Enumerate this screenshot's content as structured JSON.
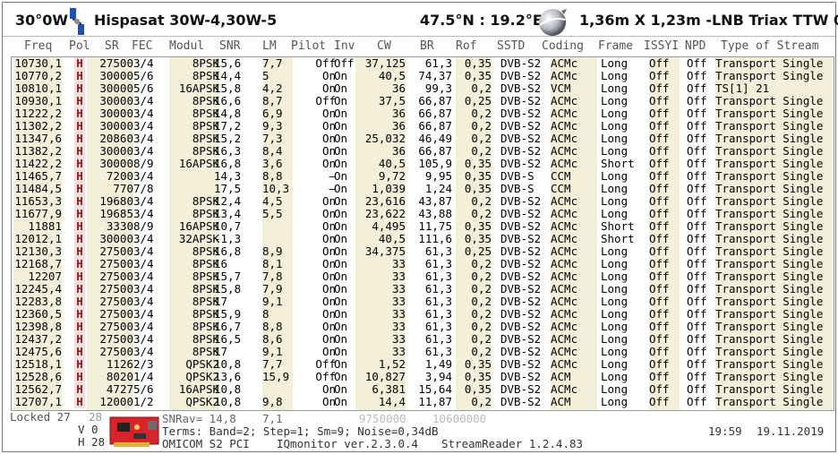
{
  "header": {
    "orbit": "30°0W",
    "satellite": "Hispasat 30W-4,30W-5",
    "coords": "47.5°N : 19.2°E",
    "dish": "1,36m X 1,23m -LNB Triax TTW 006"
  },
  "columns": [
    "Freq",
    "Pol",
    "SR",
    "FEC",
    "Modul",
    "SNR",
    "LM",
    "Pilot",
    "Inv",
    "CW",
    "BR",
    "Rof",
    "SSTD",
    "Coding",
    "Frame",
    "ISSYI",
    "NPD",
    "Type of Stream"
  ],
  "rows": [
    [
      "10730,1",
      "H",
      "27500",
      "3/4",
      "8PSK",
      "15,6",
      "7,7",
      "Off",
      "Off",
      "37,125",
      "61,3",
      "0,35",
      "DVB-S2",
      "ACMc",
      "Long",
      "Off",
      "Off",
      "Transport Single"
    ],
    [
      "10770,2",
      "H",
      "30000",
      "5/6",
      "8PSK",
      "14,4",
      "5",
      "On",
      "On",
      "40,5",
      "74,37",
      "0,35",
      "DVB-S2",
      "ACMc",
      "Long",
      "Off",
      "Off",
      "Transport Single"
    ],
    [
      "10810,1",
      "H",
      "30000",
      "5/6",
      "16APSK",
      "15,8",
      "4,2",
      "On",
      "On",
      "36",
      "99,3",
      "0,2",
      "DVB-S2",
      "VCM",
      "Long",
      "Off",
      "Off",
      "TS[1] 21"
    ],
    [
      "10930,1",
      "H",
      "30000",
      "3/4",
      "8PSK",
      "16,6",
      "8,7",
      "Off",
      "On",
      "37,5",
      "66,87",
      "0,25",
      "DVB-S2",
      "ACMc",
      "Long",
      "Off",
      "Off",
      "Transport Single"
    ],
    [
      "11222,2",
      "H",
      "30000",
      "3/4",
      "8PSK",
      "14,8",
      "6,9",
      "On",
      "On",
      "36",
      "66,87",
      "0,2",
      "DVB-S2",
      "ACMc",
      "Long",
      "Off",
      "Off",
      "Transport Single"
    ],
    [
      "11302,2",
      "H",
      "30000",
      "3/4",
      "8PSK",
      "17,2",
      "9,3",
      "On",
      "On",
      "36",
      "66,87",
      "0,2",
      "DVB-S2",
      "ACMc",
      "Long",
      "Off",
      "Off",
      "Transport Single"
    ],
    [
      "11347,6",
      "H",
      "20860",
      "3/4",
      "8PSK",
      "15,2",
      "7,3",
      "On",
      "On",
      "25,032",
      "46,49",
      "0,2",
      "DVB-S2",
      "ACMc",
      "Long",
      "Off",
      "Off",
      "Transport Single"
    ],
    [
      "11382,2",
      "H",
      "30000",
      "3/4",
      "8PSK",
      "16,3",
      "8,4",
      "On",
      "On",
      "36",
      "66,87",
      "0,2",
      "DVB-S2",
      "ACMc",
      "Long",
      "Off",
      "Off",
      "Transport Single"
    ],
    [
      "11422,2",
      "H",
      "30000",
      "8/9",
      "16APSK",
      "16,8",
      "3,6",
      "On",
      "On",
      "40,5",
      "105,9",
      "0,35",
      "DVB-S2",
      "ACMc",
      "Short",
      "Off",
      "Off",
      "Transport Single"
    ],
    [
      "11465,7",
      "H",
      "7200",
      "3/4",
      "",
      "14,3",
      "8,8",
      "–",
      "On",
      "9,72",
      "9,95",
      "0,35",
      "DVB-S",
      "CCM",
      "Long",
      "Off",
      "Off",
      "Transport Single"
    ],
    [
      "11484,5",
      "H",
      "770",
      "7/8",
      "",
      "17,5",
      "10,3",
      "–",
      "On",
      "1,039",
      "1,24",
      "0,35",
      "DVB-S",
      "CCM",
      "Long",
      "Off",
      "Off",
      "Transport Single"
    ],
    [
      "11653,3",
      "H",
      "19680",
      "3/4",
      "8PSK",
      "12,4",
      "4,5",
      "On",
      "On",
      "23,616",
      "43,87",
      "0,2",
      "DVB-S2",
      "ACMc",
      "Long",
      "Off",
      "Off",
      "Transport Single"
    ],
    [
      "11677,9",
      "H",
      "19685",
      "3/4",
      "8PSK",
      "13,4",
      "5,5",
      "On",
      "On",
      "23,622",
      "43,88",
      "0,2",
      "DVB-S2",
      "ACMc",
      "Long",
      "Off",
      "Off",
      "Transport Single"
    ],
    [
      "11881",
      "H",
      "3330",
      "8/9",
      "16APSK",
      "10,7",
      "",
      "On",
      "On",
      "4,495",
      "11,75",
      "0,35",
      "DVB-S2",
      "ACMc",
      "Short",
      "Off",
      "Off",
      "Transport Single"
    ],
    [
      "12012,1",
      "H",
      "30000",
      "3/4",
      "32APSK",
      "-1,3",
      "",
      "On",
      "On",
      "40,5",
      "111,6",
      "0,35",
      "DVB-S2",
      "ACMc",
      "Short",
      "Off",
      "Off",
      "Transport Single"
    ],
    [
      "12130,3",
      "H",
      "27500",
      "3/4",
      "8PSK",
      "16,8",
      "8,9",
      "On",
      "On",
      "34,375",
      "61,3",
      "0,25",
      "DVB-S2",
      "ACMc",
      "Long",
      "Off",
      "Off",
      "Transport Single"
    ],
    [
      "12168,7",
      "H",
      "27500",
      "3/4",
      "8PSK",
      "16",
      "8,1",
      "On",
      "On",
      "33",
      "61,3",
      "0,2",
      "DVB-S2",
      "ACMc",
      "Long",
      "Off",
      "Off",
      "Transport Single"
    ],
    [
      "12207",
      "H",
      "27500",
      "3/4",
      "8PSK",
      "15,7",
      "7,8",
      "On",
      "On",
      "33",
      "61,3",
      "0,2",
      "DVB-S2",
      "ACMc",
      "Long",
      "Off",
      "Off",
      "Transport Single"
    ],
    [
      "12245,4",
      "H",
      "27500",
      "3/4",
      "8PSK",
      "15,8",
      "7,9",
      "On",
      "On",
      "33",
      "61,3",
      "0,2",
      "DVB-S2",
      "ACMc",
      "Long",
      "Off",
      "Off",
      "Transport Single"
    ],
    [
      "12283,8",
      "H",
      "27500",
      "3/4",
      "8PSK",
      "17",
      "9,1",
      "On",
      "On",
      "33",
      "61,3",
      "0,2",
      "DVB-S2",
      "ACMc",
      "Long",
      "Off",
      "Off",
      "Transport Single"
    ],
    [
      "12360,5",
      "H",
      "27500",
      "3/4",
      "8PSK",
      "15,9",
      "8",
      "On",
      "On",
      "33",
      "61,3",
      "0,2",
      "DVB-S2",
      "ACMc",
      "Long",
      "Off",
      "Off",
      "Transport Single"
    ],
    [
      "12398,8",
      "H",
      "27500",
      "3/4",
      "8PSK",
      "16,7",
      "8,8",
      "On",
      "On",
      "33",
      "61,3",
      "0,2",
      "DVB-S2",
      "ACMc",
      "Long",
      "Off",
      "Off",
      "Transport Single"
    ],
    [
      "12437,2",
      "H",
      "27500",
      "3/4",
      "8PSK",
      "16,5",
      "8,6",
      "On",
      "On",
      "33",
      "61,3",
      "0,2",
      "DVB-S2",
      "ACMc",
      "Long",
      "Off",
      "Off",
      "Transport Single"
    ],
    [
      "12475,6",
      "H",
      "27500",
      "3/4",
      "8PSK",
      "17",
      "9,1",
      "On",
      "On",
      "33",
      "61,3",
      "0,2",
      "DVB-S2",
      "ACMc",
      "Long",
      "Off",
      "Off",
      "Transport Single"
    ],
    [
      "12518,1",
      "H",
      "1126",
      "2/3",
      "QPSK2",
      "10,8",
      "7,7",
      "Off",
      "On",
      "1,52",
      "1,49",
      "0,35",
      "DVB-S2",
      "ACMc",
      "Long",
      "Off",
      "Off",
      "Transport Single"
    ],
    [
      "12528,6",
      "H",
      "8020",
      "1/4",
      "QPSK2",
      "13,6",
      "15,9",
      "Off",
      "On",
      "10,827",
      "3,94",
      "0,35",
      "DVB-S2",
      "ACM",
      "Long",
      "Off",
      "Off",
      "Transport Single"
    ],
    [
      "12562,7",
      "H",
      "4727",
      "5/6",
      "16APSK",
      "10,8",
      "",
      "On",
      "On",
      "6,381",
      "15,64",
      "0,35",
      "DVB-S2",
      "ACMc",
      "Long",
      "Off",
      "Off",
      "Transport Single"
    ],
    [
      "12707,1",
      "H",
      "12000",
      "1/2",
      "QPSK2",
      "10,8",
      "9,8",
      "On",
      "On",
      "14,4",
      "11,87",
      "0,2",
      "DVB-S2",
      "ACM",
      "Long",
      "Off",
      "Off",
      "Transport Single"
    ]
  ],
  "footer": {
    "locked_label": "Locked 27",
    "locked_count": "28",
    "v_label": "V 0",
    "h_label": "H 28",
    "snrav": "SNRav= 14,8",
    "lmav": "7,1",
    "range_lo": "9750000",
    "range_hi": "10600000",
    "terms": "Terms:  Band=2; Step=1; Sm=9; Noise=0,34dB",
    "device": "OMICOM S2 PCI",
    "iqmonitor": "IQmonitor ver.2.3.0.4",
    "streamreader": "StreamReader 1.2.4.83",
    "time": "19:59",
    "date": "19.11.2019"
  },
  "colors": {
    "band": "#f3efd9",
    "pol_h": "#f6dede",
    "satellite_icon": "#1e4fbf",
    "card": "#d8232a"
  },
  "icons": [
    "satellite-icon",
    "globe-icon",
    "tuner-card-icon"
  ]
}
